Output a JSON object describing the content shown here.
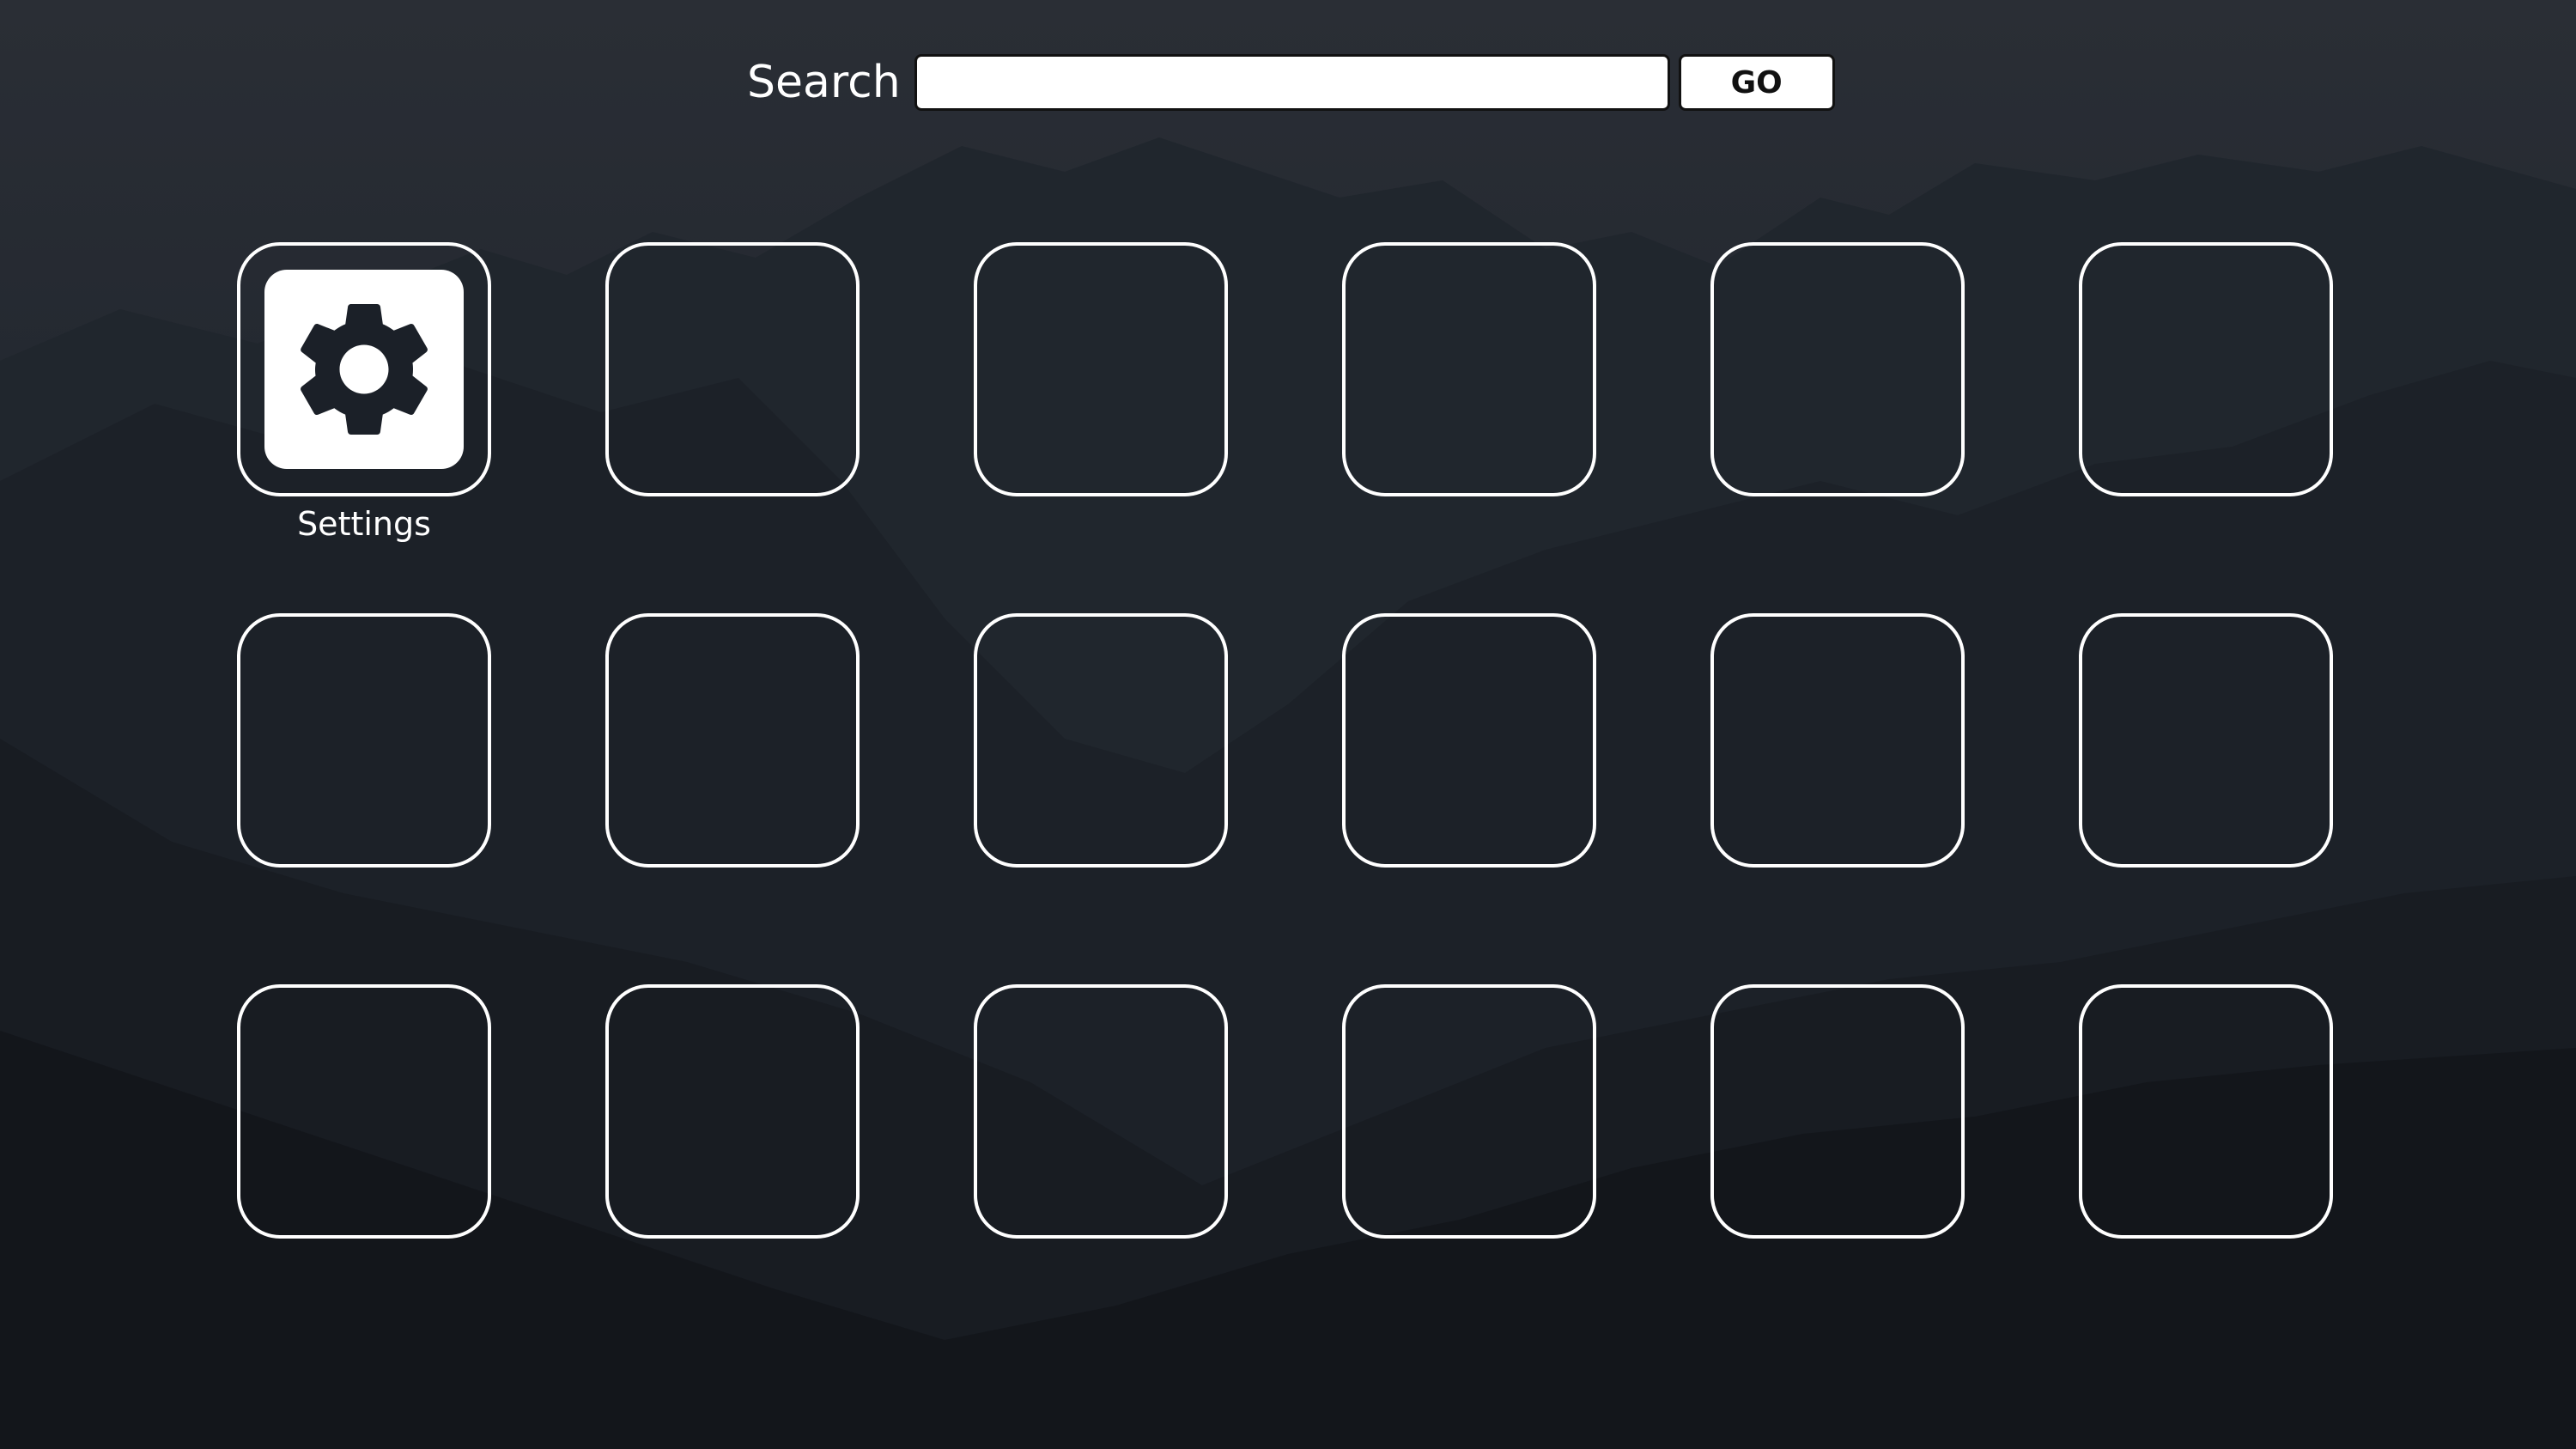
{
  "search": {
    "label": "Search",
    "value": "",
    "placeholder": "",
    "go_label": "GO"
  },
  "apps": [
    {
      "label": "Settings",
      "icon": "gear-icon"
    },
    {
      "label": ""
    },
    {
      "label": ""
    },
    {
      "label": ""
    },
    {
      "label": ""
    },
    {
      "label": ""
    },
    {
      "label": ""
    },
    {
      "label": ""
    },
    {
      "label": ""
    },
    {
      "label": ""
    },
    {
      "label": ""
    },
    {
      "label": ""
    },
    {
      "label": ""
    },
    {
      "label": ""
    },
    {
      "label": ""
    },
    {
      "label": ""
    },
    {
      "label": ""
    },
    {
      "label": ""
    }
  ],
  "colors": {
    "tile_border": "#ffffff",
    "icon_background": "#ffffff",
    "icon_glyph": "#1b2028"
  }
}
